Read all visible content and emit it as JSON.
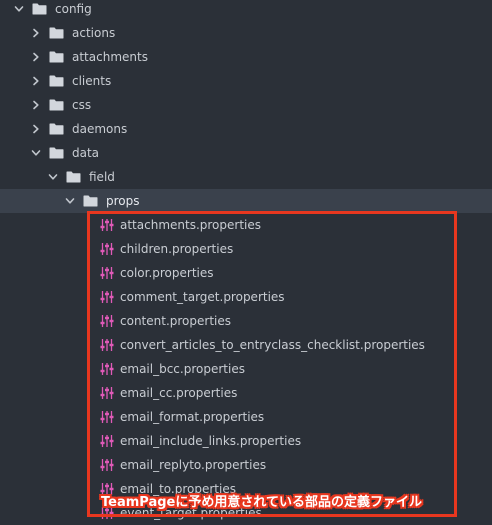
{
  "colors": {
    "background": "#2b3038",
    "selected_row": "#3a414c",
    "folder": "#d2d6dc",
    "property_icon": "#e05ab8",
    "highlight": "#e8371f"
  },
  "tree": {
    "root": {
      "label": "config",
      "icon": "folder-icon",
      "expanded": true
    },
    "children": [
      {
        "label": "actions",
        "icon": "folder-icon",
        "expanded": false
      },
      {
        "label": "attachments",
        "icon": "folder-icon",
        "expanded": false
      },
      {
        "label": "clients",
        "icon": "folder-icon",
        "expanded": false
      },
      {
        "label": "css",
        "icon": "folder-icon",
        "expanded": false
      },
      {
        "label": "daemons",
        "icon": "folder-icon",
        "expanded": false
      },
      {
        "label": "data",
        "icon": "folder-icon",
        "expanded": true
      }
    ],
    "field": {
      "label": "field",
      "icon": "folder-icon",
      "expanded": true
    },
    "props": {
      "label": "props",
      "icon": "folder-icon",
      "expanded": true,
      "selected": true
    },
    "files": [
      "attachments.properties",
      "children.properties",
      "color.properties",
      "comment_target.properties",
      "content.properties",
      "convert_articles_to_entryclass_checklist.properties",
      "email_bcc.properties",
      "email_cc.properties",
      "email_format.properties",
      "email_include_links.properties",
      "email_replyto.properties",
      "email_to.properties",
      "event_target.properties"
    ]
  },
  "annotation": {
    "caption": "TeamPageに予め用意されている部品の定義ファイル"
  }
}
